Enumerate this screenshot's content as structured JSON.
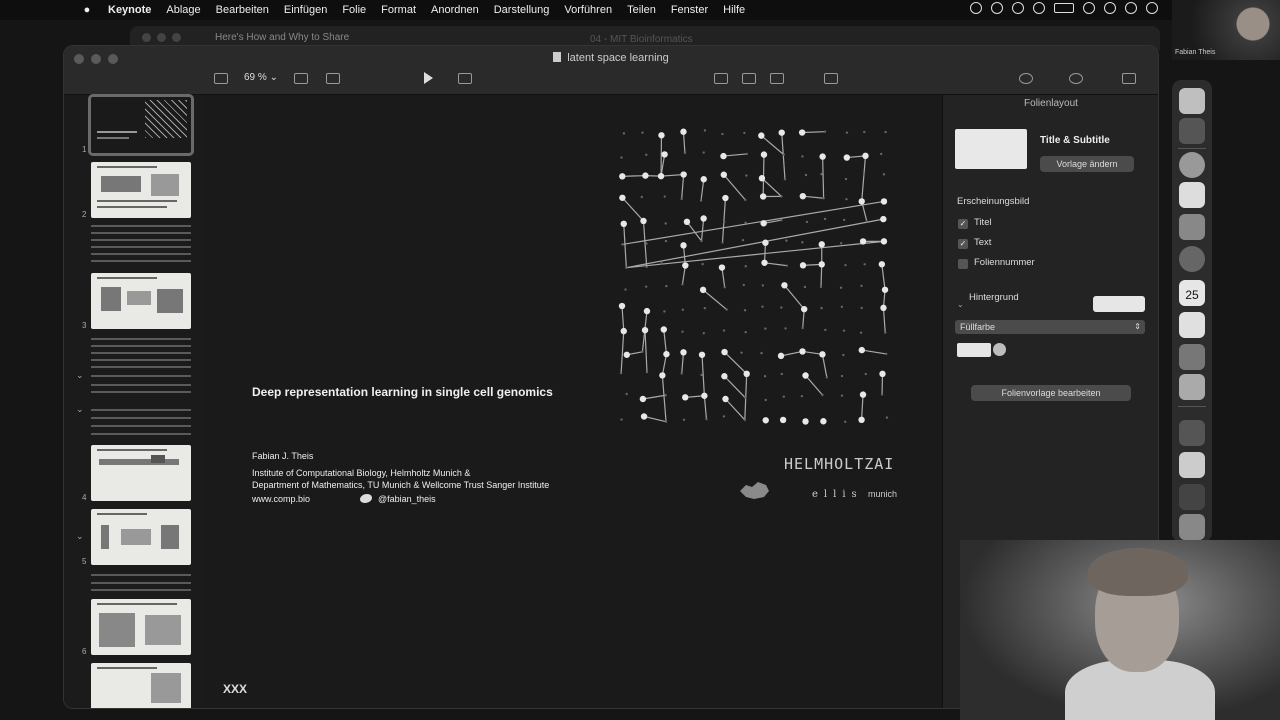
{
  "menubar": {
    "app": "Keynote",
    "items": [
      "Ablage",
      "Bearbeiten",
      "Einfügen",
      "Folie",
      "Format",
      "Anordnen",
      "Darstellung",
      "Vorführen",
      "Teilen",
      "Fenster",
      "Hilfe"
    ]
  },
  "background_window": {
    "tab1": "Here's How and Why to Share",
    "tab2": "04 - MIT Bioinformatics"
  },
  "webcam_small": {
    "caption": "Fabian Theis"
  },
  "window": {
    "title": "latent space learning",
    "zoom": "69 %"
  },
  "navigator": {
    "slide_numbers": [
      "1",
      "2",
      "3",
      "4",
      "5",
      "6"
    ]
  },
  "slide": {
    "title": "Deep representation learning in single cell genomics",
    "author": "Fabian J. Theis",
    "institution_line1": "Institute of Computational Biology, Helmholtz Munich &",
    "institution_line2": "Department of Mathematics, TU Munich & Wellcome Trust Sanger Institute",
    "website": "www.comp.bio",
    "twitter": "@fabian_theis",
    "logo_helmholtz": "HELMHOLTZAI",
    "logo_ellis": "ellis",
    "logo_munich": "munich",
    "footer": "XXX"
  },
  "inspector": {
    "panel_title": "Folienlayout",
    "layout_name": "Title & Subtitle",
    "change_template_button": "Vorlage ändern",
    "appearance_section": "Erscheinungsbild",
    "checkboxes": [
      {
        "label": "Titel",
        "checked": true
      },
      {
        "label": "Text",
        "checked": true
      },
      {
        "label": "Foliennummer",
        "checked": false
      }
    ],
    "background_section": "Hintergrund",
    "fill_select": "Füllfarbe",
    "edit_template_button": "Folienvorlage bearbeiten"
  },
  "dock": {
    "calendar_day": "25"
  }
}
